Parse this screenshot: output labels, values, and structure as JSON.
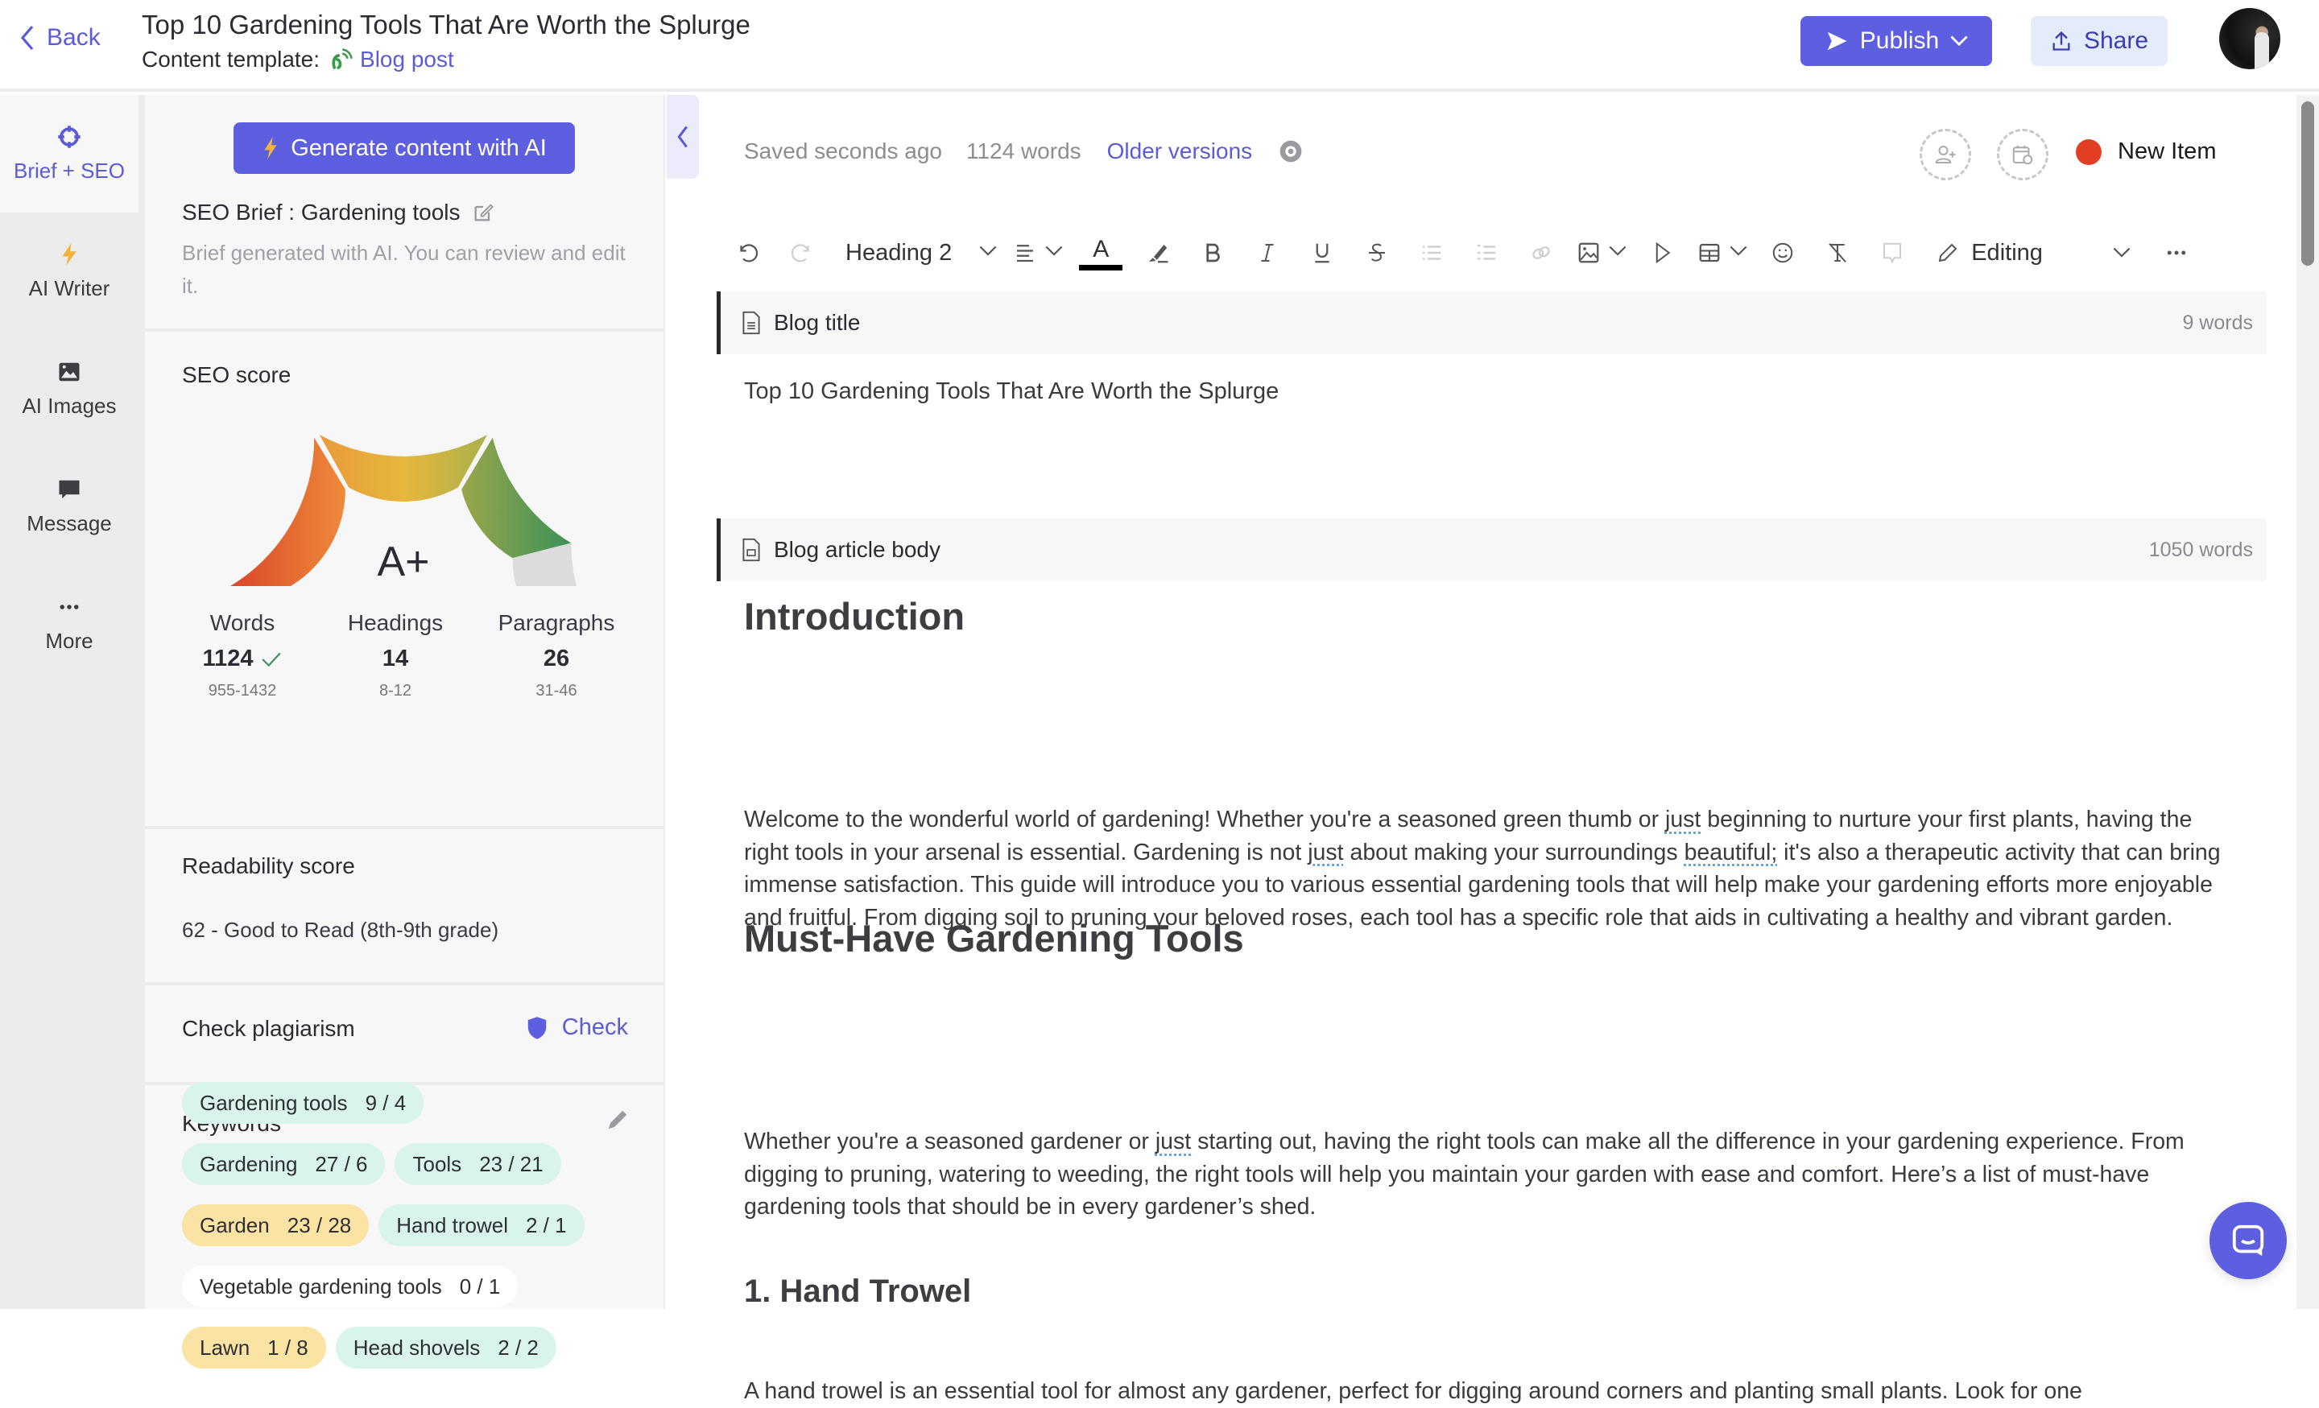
{
  "header": {
    "back_label": "Back",
    "title": "Top 10 Gardening Tools That Are Worth the Splurge",
    "template_label": "Content template:",
    "template_name": "Blog post",
    "publish_label": "Publish",
    "share_label": "Share"
  },
  "rail": {
    "items": [
      {
        "label": "Brief + SEO",
        "icon": "crosshair-icon",
        "active": true
      },
      {
        "label": "AI Writer",
        "icon": "lightning-icon",
        "active": false
      },
      {
        "label": "AI Images",
        "icon": "image-icon",
        "active": false
      },
      {
        "label": "Message",
        "icon": "chat-bubble-icon",
        "active": false
      },
      {
        "label": "More",
        "icon": "more-dots-icon",
        "active": false
      }
    ]
  },
  "panel": {
    "generate_label": "Generate content with AI",
    "brief_title": "SEO Brief : Gardening tools",
    "brief_desc": "Brief generated with AI. You can review and edit it.",
    "seo_title": "SEO score",
    "seo_grade": "A+",
    "seo_gauge_fill_fraction": 0.92,
    "stats": [
      {
        "label": "Words",
        "value": "1124",
        "range": "955-1432",
        "ok": true
      },
      {
        "label": "Headings",
        "value": "14",
        "range": "8-12",
        "ok": false
      },
      {
        "label": "Paragraphs",
        "value": "26",
        "range": "31-46",
        "ok": false
      }
    ],
    "readability_title": "Readability score",
    "readability_value": "62 - Good to Read (8th-9th grade)",
    "plagiarism_title": "Check plagiarism",
    "plagiarism_action": "Check",
    "keywords_title": "Keywords",
    "keywords": [
      {
        "term": "Gardening tools",
        "count": "9 / 4",
        "status": "ok"
      },
      {
        "term": "Gardening",
        "count": "27 / 6",
        "status": "ok"
      },
      {
        "term": "Tools",
        "count": "23 / 21",
        "status": "ok"
      },
      {
        "term": "Garden",
        "count": "23 / 28",
        "status": "under"
      },
      {
        "term": "Hand trowel",
        "count": "2 / 1",
        "status": "ok"
      },
      {
        "term": "Vegetable gardening tools",
        "count": "0 / 1",
        "status": "none"
      },
      {
        "term": "Lawn",
        "count": "1 / 8",
        "status": "under"
      },
      {
        "term": "Head shovels",
        "count": "2 / 2",
        "status": "ok"
      }
    ]
  },
  "editor": {
    "saved_status": "Saved seconds ago",
    "word_count": "1124 words",
    "older_versions": "Older versions",
    "status_label": "New Item",
    "status_color": "#e23f22",
    "toolbar": {
      "block_style": "Heading 2",
      "mode": "Editing"
    },
    "blocks": [
      {
        "label": "Blog title",
        "words": "9 words"
      },
      {
        "label": "Blog article body",
        "words": "1050 words"
      }
    ],
    "title_text": "Top 10 Gardening Tools That Are Worth the Splurge",
    "body": {
      "h_intro": "Introduction",
      "p_intro_1": "Welcome to the wonderful world of gardening! Whether you're a seasoned green thumb or ",
      "p_intro_just1": "just",
      "p_intro_2": " beginning to nurture your first plants, having the right tools in your arsenal is essential. Gardening is not ",
      "p_intro_just2": "just",
      "p_intro_3": " about making your surroundings ",
      "p_intro_beautiful": "beautiful;",
      "p_intro_4": " it's also a therapeutic activity that can bring immense satisfaction. This guide will introduce you to various essential gardening tools that will help make your gardening efforts more enjoyable and fruitful. From digging soil to pruning your beloved roses, each tool has a specific role that aids in cultivating a healthy and vibrant garden.",
      "h_musthave": "Must-Have Gardening Tools",
      "p_must_1": "Whether you're a seasoned gardener or ",
      "p_must_just": "just",
      "p_must_2": " starting out, having the right tools can make all the difference in your gardening experience. From digging to pruning, watering to weeding, the right tools will help you maintain your garden with ease and comfort. Here’s a list of must-have gardening tools that should be in every gardener’s shed.",
      "h_trowel": "1. Hand Trowel",
      "p_trowel": "A hand trowel is an essential tool for almost any gardener, perfect for digging around corners and planting small plants. Look for one"
    }
  },
  "colors": {
    "accent": "#5d5fe0",
    "link": "#5b5bd6",
    "keyword_ok": "#d9f4ec",
    "keyword_under": "#fbe3a3"
  }
}
